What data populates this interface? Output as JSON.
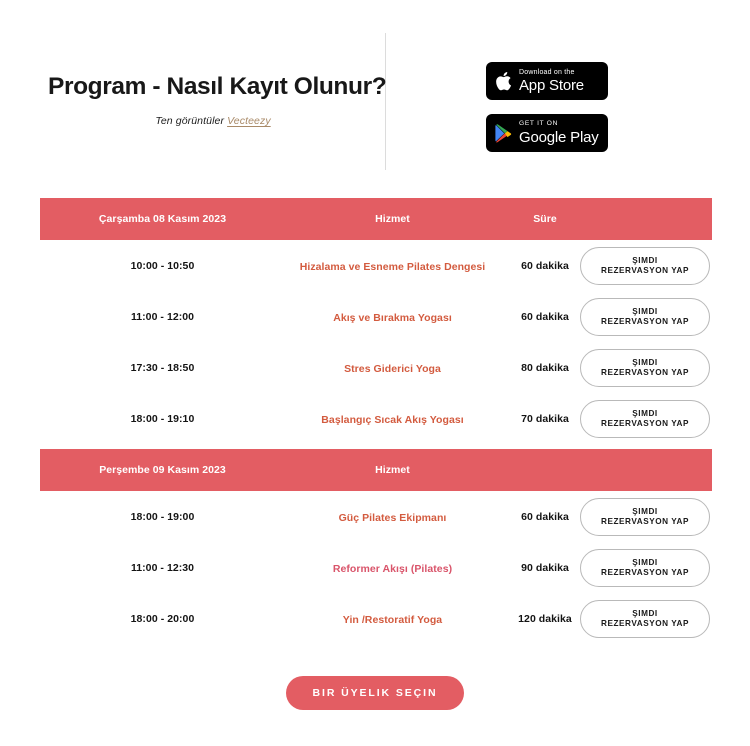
{
  "header": {
    "title": "Program - Nasıl Kayıt Olunur?",
    "subtitle_prefix": "Ten görüntüler",
    "subtitle_brand": "Vecteezy"
  },
  "badges": [
    {
      "icon": "apple-logo-icon",
      "small": "Download on the",
      "big": "App Store"
    },
    {
      "icon": "google-play-icon",
      "small": "GET IT ON",
      "big": "Google Play"
    }
  ],
  "colors": {
    "accent_red": "#e35d63",
    "service_link": "#d35b3f",
    "service_link_alt": "#d9546a",
    "brand_tan": "#a98a68",
    "text_dark": "#141414",
    "button_border": "#b9b9b9",
    "divider": "#dcdcdc"
  },
  "table": {
    "columns": {
      "date": "Çarşamba 08 Kasım 2023",
      "service": "Hizmet",
      "duration": "Süre"
    },
    "book_button": {
      "line1": "ŞIMDI",
      "line2": "REZERVASYON YAP"
    },
    "sections": [
      {
        "date": "Çarşamba 08 Kasım 2023",
        "service_header": "Hizmet",
        "duration_header": "Süre",
        "rows": [
          {
            "time": "10:00 - 10:50",
            "service": "Hizalama ve Esneme Pilates Dengesi",
            "duration": "60 dakika",
            "color": "#d35b3f"
          },
          {
            "time": "11:00 - 12:00",
            "service": "Akış ve Bırakma Yogası",
            "duration": "60 dakika",
            "color": "#d35b3f"
          },
          {
            "time": "17:30 - 18:50",
            "service": "Stres Giderici Yoga",
            "duration": "80 dakika",
            "color": "#d35b3f"
          },
          {
            "time": "18:00 - 19:10",
            "service": "Başlangıç Sıcak Akış Yogası",
            "duration": "70 dakika",
            "color": "#d35b3f"
          }
        ]
      },
      {
        "date": "Perşembe 09 Kasım 2023",
        "service_header": "Hizmet",
        "duration_header": "",
        "rows": [
          {
            "time": "18:00 - 19:00",
            "service": "Güç Pilates Ekipmanı",
            "duration": "60 dakika",
            "color": "#d35b3f"
          },
          {
            "time": "11:00 - 12:30",
            "service": "Reformer Akışı (Pilates)",
            "duration": "90 dakika",
            "color": "#d9546a"
          },
          {
            "time": "18:00 - 20:00",
            "service": "Yin /Restoratif Yoga",
            "duration": "120 dakika",
            "color": "#d35b3f"
          }
        ]
      }
    ]
  },
  "cta": {
    "label": "BIR ÜYELIK SEÇIN"
  }
}
